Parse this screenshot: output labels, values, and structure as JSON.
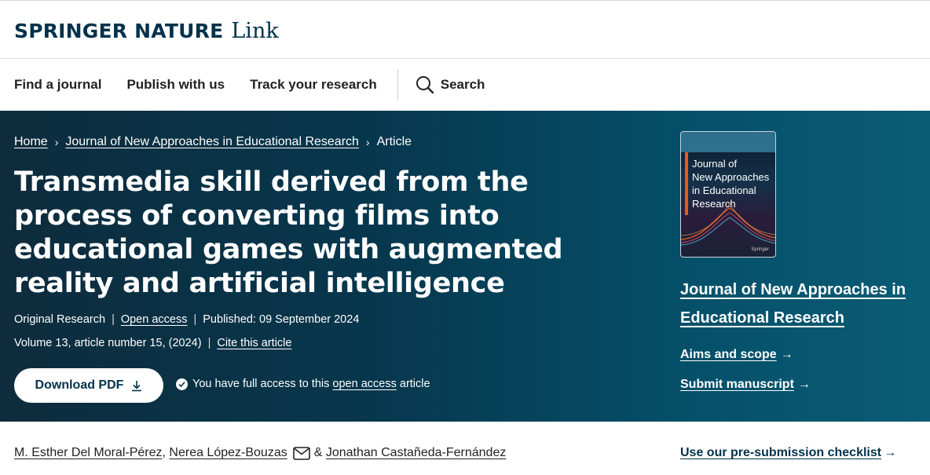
{
  "brand": {
    "main": "SPRINGER NATURE",
    "sub": "Link"
  },
  "nav": {
    "items": [
      "Find a journal",
      "Publish with us",
      "Track your research"
    ],
    "search_label": "Search"
  },
  "breadcrumb": {
    "home": "Home",
    "journal": "Journal of New Approaches in Educational Research",
    "current": "Article",
    "separator": "›"
  },
  "article": {
    "title": "Transmedia skill derived from the process of converting films into educational games with augmented reality and artificial intelligence",
    "type": "Original Research",
    "open_access": "Open access",
    "published": "Published: 09 September 2024",
    "volume": "Volume 13, article number 15, (2024)",
    "cite": "Cite this article",
    "download_pdf": "Download PDF",
    "access_prefix": "You have full access to this",
    "access_link": "open access",
    "access_suffix": "article"
  },
  "cover": {
    "title_lines": [
      "Journal of",
      "New Approaches",
      "in Educational",
      "Research"
    ],
    "publisher": "Springer"
  },
  "sidebar": {
    "journal_name": "Journal of New Approaches in Educational Research",
    "aims": "Aims and scope",
    "submit": "Submit manuscript",
    "checklist": "Use our pre-submission checklist"
  },
  "authors": {
    "a1": "M. Esther Del Moral-Pérez",
    "a2": "Nerea López-Bouzas",
    "a3": "Jonathan Castañeda-Fernández",
    "comma": ",",
    "amp": "&"
  },
  "colors": {
    "hero": "#07374d",
    "brand": "#01324b",
    "cover_accent": "#e35b1e"
  }
}
